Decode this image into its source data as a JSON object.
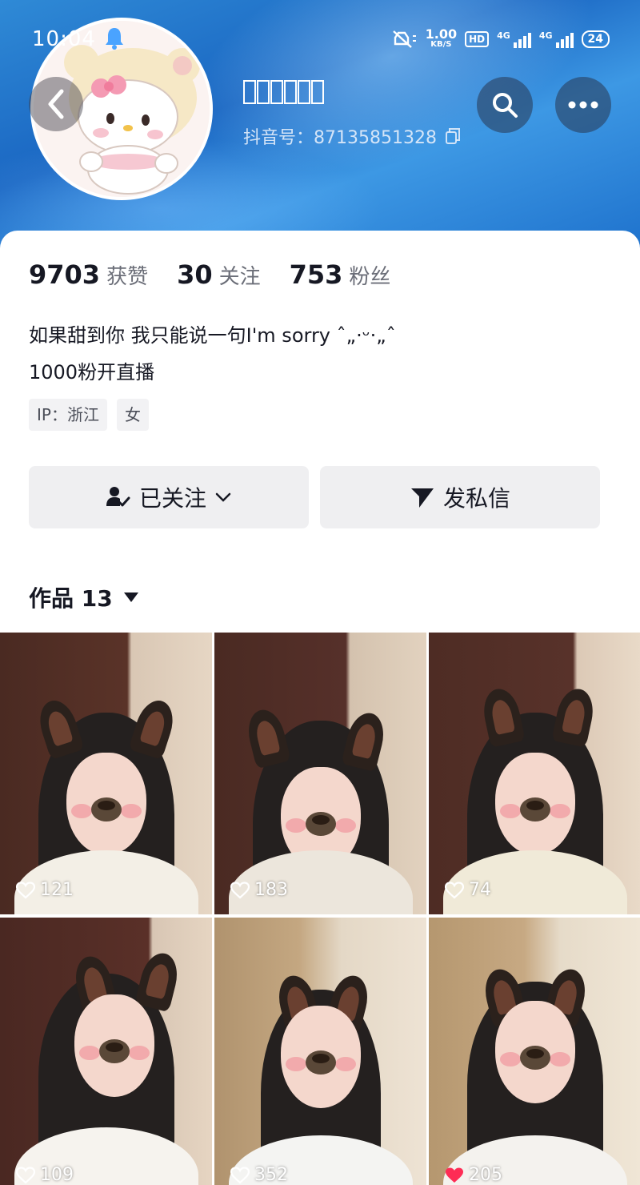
{
  "status_bar": {
    "time": "10:04",
    "net_speed_value": "1.00",
    "net_speed_unit": "KB/S",
    "hd_label": "HD",
    "signal1_label": "4G",
    "signal2_label": "4G",
    "battery": "24"
  },
  "profile": {
    "nickname": "□□□□□□",
    "douyin_id": "抖音号：87135851328"
  },
  "stats": [
    {
      "value": "9703",
      "label": "获赞"
    },
    {
      "value": "30",
      "label": "关注"
    },
    {
      "value": "753",
      "label": "粉丝"
    }
  ],
  "bio": {
    "line1": "如果甜到你 我只能说一句I'm sorry ˆ„·ᵕ·„ˆ",
    "line2": "1000粉开直播"
  },
  "tags": [
    "IP：浙江",
    "女"
  ],
  "actions": {
    "following_label": "已关注",
    "message_label": "发私信"
  },
  "works": {
    "label": "作品 13"
  },
  "videos": [
    {
      "likes": "121",
      "liked": false
    },
    {
      "likes": "183",
      "liked": false
    },
    {
      "likes": "74",
      "liked": false
    },
    {
      "likes": "109",
      "liked": false
    },
    {
      "likes": "352",
      "liked": false
    },
    {
      "likes": "205",
      "liked": true
    }
  ],
  "colors": {
    "banner": "#1a66c2",
    "liked_heart": "#fe2c55",
    "button_bg": "#efeff1"
  }
}
